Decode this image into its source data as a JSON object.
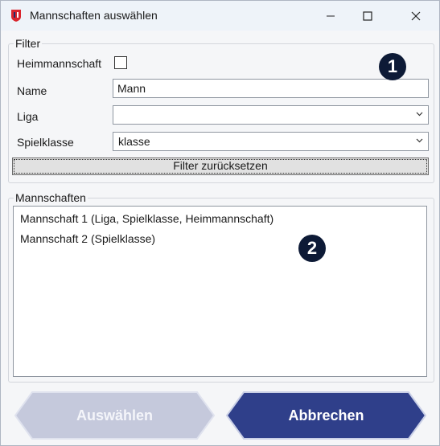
{
  "window": {
    "title": "Mannschaften auswählen",
    "icon": "app-logo-icon"
  },
  "filter": {
    "legend": "Filter",
    "home_team": {
      "label": "Heimmannschaft",
      "checked": false
    },
    "name": {
      "label": "Name",
      "value": "Mann"
    },
    "league": {
      "label": "Liga",
      "value": ""
    },
    "class": {
      "label": "Spielklasse",
      "value": "klasse"
    },
    "reset_label": "Filter zurücksetzen"
  },
  "teams": {
    "legend": "Mannschaften",
    "items": [
      {
        "label": "Mannschaft 1 (Liga, Spielklasse, Heimmannschaft)"
      },
      {
        "label": "Mannschaft 2 (Spielklasse)"
      }
    ]
  },
  "badges": {
    "one": "1",
    "two": "2"
  },
  "actions": {
    "select_label": "Auswählen",
    "cancel_label": "Abbrechen"
  },
  "colors": {
    "badge": "#0d1a36",
    "cancel_button": "#2f3f8a",
    "select_button_disabled": "#c5c9dc",
    "titlebar": "#eef3f9"
  }
}
